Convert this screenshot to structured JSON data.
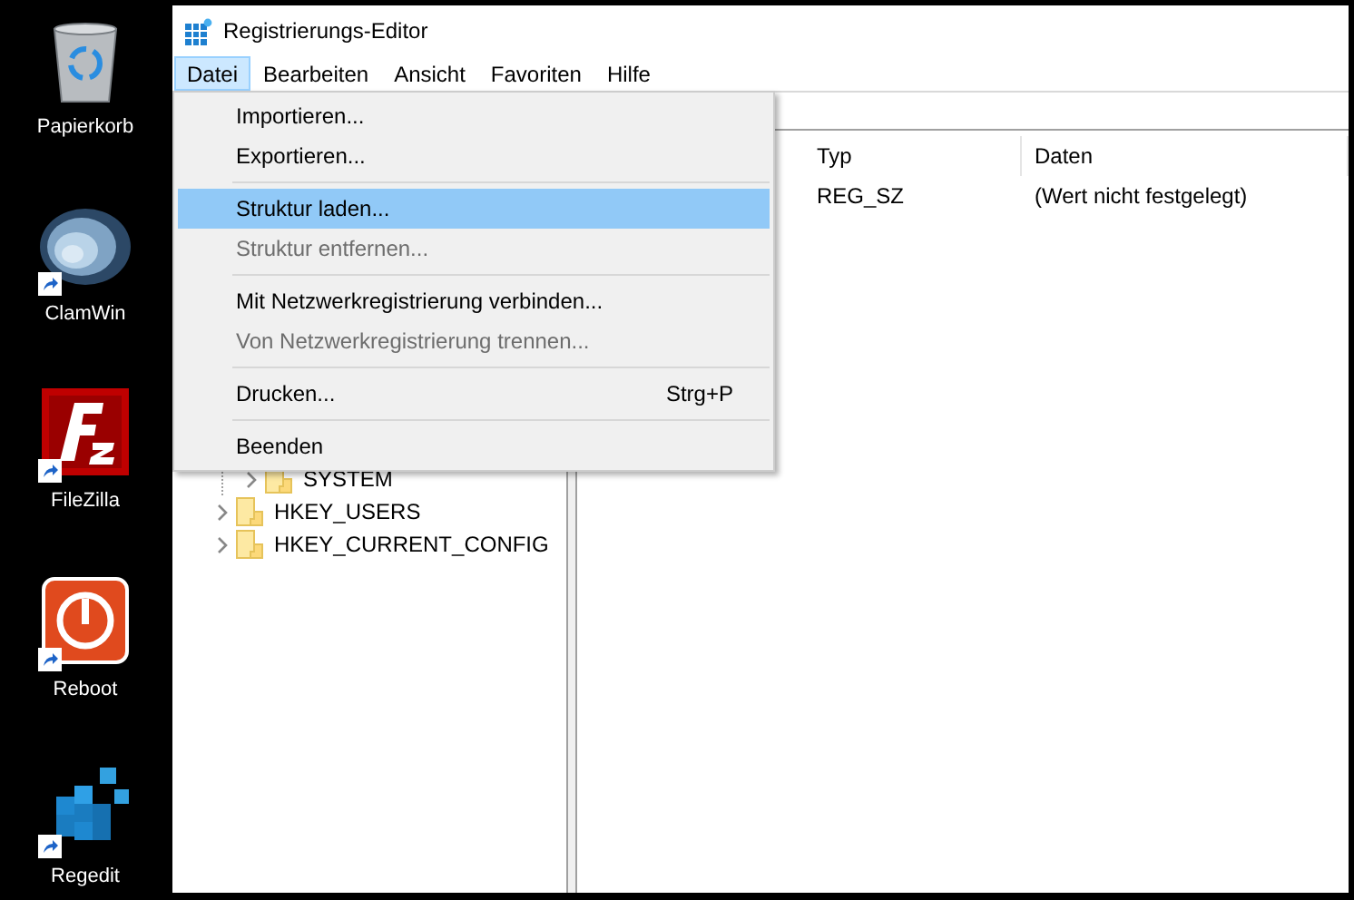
{
  "desktop_icons": [
    {
      "label": "Papierkorb",
      "kind": "recycle-bin",
      "shortcut": false
    },
    {
      "label": "ClamWin",
      "kind": "shell",
      "shortcut": true
    },
    {
      "label": "FileZilla",
      "kind": "red-tile",
      "shortcut": true
    },
    {
      "label": "Reboot",
      "kind": "power",
      "shortcut": true
    },
    {
      "label": "Regedit",
      "kind": "cubes",
      "shortcut": true
    }
  ],
  "window": {
    "title": "Registrierungs-Editor"
  },
  "menubar": [
    {
      "label": "Datei",
      "selected": true
    },
    {
      "label": "Bearbeiten",
      "selected": false
    },
    {
      "label": "Ansicht",
      "selected": false
    },
    {
      "label": "Favoriten",
      "selected": false
    },
    {
      "label": "Hilfe",
      "selected": false
    }
  ],
  "menu": [
    {
      "kind": "item",
      "label": "Importieren...",
      "disabled": false,
      "selected": false
    },
    {
      "kind": "item",
      "label": "Exportieren...",
      "disabled": false,
      "selected": false
    },
    {
      "kind": "separator"
    },
    {
      "kind": "item",
      "label": "Struktur laden...",
      "disabled": false,
      "selected": true
    },
    {
      "kind": "item",
      "label": "Struktur entfernen...",
      "disabled": true,
      "selected": false
    },
    {
      "kind": "separator"
    },
    {
      "kind": "item",
      "label": "Mit Netzwerkregistrierung verbinden...",
      "disabled": false,
      "selected": false
    },
    {
      "kind": "item",
      "label": "Von Netzwerkregistrierung trennen...",
      "disabled": true,
      "selected": false
    },
    {
      "kind": "separator"
    },
    {
      "kind": "item",
      "label": "Drucken...",
      "shortcut": "Strg+P",
      "disabled": false,
      "selected": false
    },
    {
      "kind": "separator"
    },
    {
      "kind": "item",
      "label": "Beenden",
      "disabled": false,
      "selected": false
    }
  ],
  "tree": [
    {
      "children": [
        {
          "label": "SYSTEM",
          "expanded": false
        }
      ]
    },
    {
      "label": "HKEY_USERS",
      "expanded": false
    },
    {
      "label": "HKEY_CURRENT_CONFIG",
      "expanded": false
    }
  ],
  "table": {
    "columns": [
      "Typ",
      "Daten"
    ],
    "rows": [
      {
        "cells": [
          "REG_SZ",
          "(Wert nicht festgelegt)"
        ]
      }
    ]
  }
}
